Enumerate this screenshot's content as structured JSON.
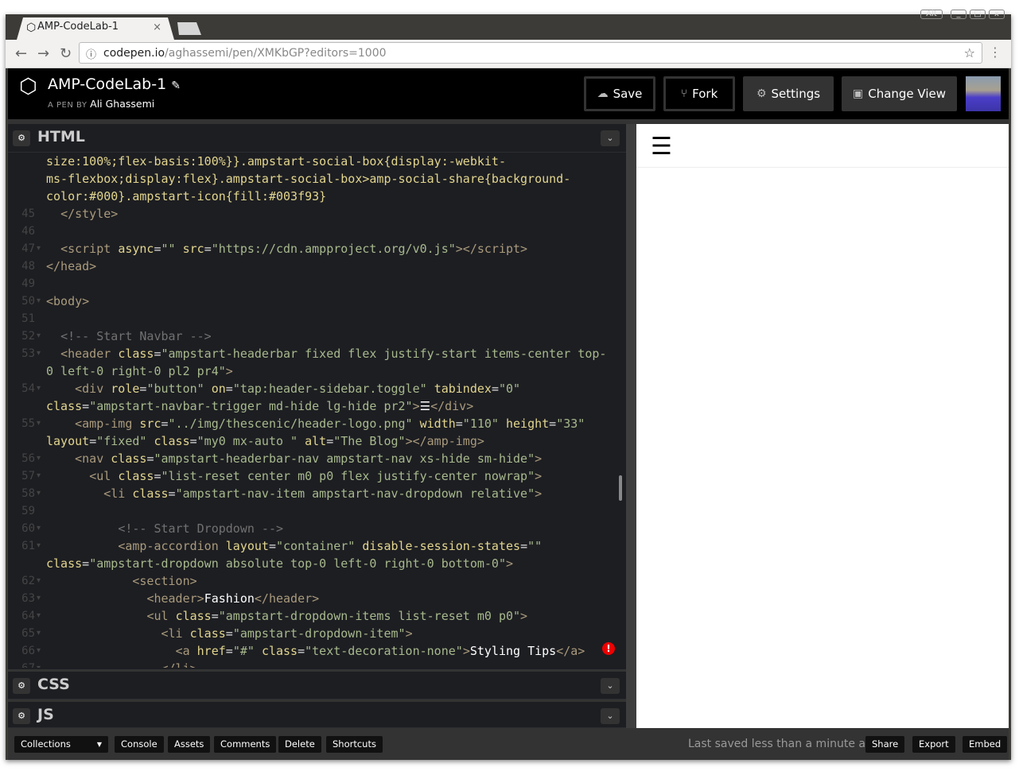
{
  "browser": {
    "tab_title": "AMP-CodeLab-1",
    "tab_icon": "codepen-logo-icon",
    "url_host": "codepen.io",
    "url_path": "/aghassemi/pen/XMKbGP?editors=1000",
    "window_controls": [
      "Alt",
      "_",
      "□",
      "x"
    ]
  },
  "header": {
    "title": "AMP-CodeLab-1",
    "by_label": "A PEN BY",
    "author": "Ali Ghassemi",
    "buttons": {
      "save": "Save",
      "fork": "Fork",
      "settings": "Settings",
      "change_view": "Change View"
    }
  },
  "panels": {
    "html": "HTML",
    "css": "CSS",
    "js": "JS"
  },
  "code_lines": [
    {
      "n": "",
      "f": false,
      "tokens": [
        [
          "a",
          "size:100%;flex-basis:100%}}.ampstart-social-box{display:-webkit-"
        ]
      ]
    },
    {
      "n": "",
      "f": false,
      "tokens": [
        [
          "a",
          "ms-flexbox;display:flex}.ampstart-social-box>amp-social-share{background-"
        ]
      ]
    },
    {
      "n": "",
      "f": false,
      "tokens": [
        [
          "a",
          "color:#000}.ampstart-icon{fill:#003f93}"
        ]
      ]
    },
    {
      "n": "45",
      "f": false,
      "tokens": [
        [
          "p",
          "  "
        ],
        [
          "t",
          "</style>"
        ]
      ]
    },
    {
      "n": "46",
      "f": false,
      "tokens": []
    },
    {
      "n": "47",
      "f": true,
      "tokens": [
        [
          "p",
          "  "
        ],
        [
          "t",
          "<script "
        ],
        [
          "a",
          "async"
        ],
        [
          "p",
          "="
        ],
        [
          "s",
          "\"\" "
        ],
        [
          "a",
          "src"
        ],
        [
          "p",
          "="
        ],
        [
          "s",
          "\"https://cdn.ampproject.org/v0.js\""
        ],
        [
          "t",
          "></script>"
        ]
      ]
    },
    {
      "n": "48",
      "f": false,
      "tokens": [
        [
          "t",
          "</head>"
        ]
      ]
    },
    {
      "n": "49",
      "f": false,
      "tokens": []
    },
    {
      "n": "50",
      "f": true,
      "tokens": [
        [
          "t",
          "<body>"
        ]
      ]
    },
    {
      "n": "51",
      "f": false,
      "tokens": []
    },
    {
      "n": "52",
      "f": true,
      "tokens": [
        [
          "p",
          "  "
        ],
        [
          "c",
          "<!-- Start Navbar -->"
        ]
      ]
    },
    {
      "n": "53",
      "f": true,
      "tokens": [
        [
          "p",
          "  "
        ],
        [
          "t",
          "<header "
        ],
        [
          "a",
          "class"
        ],
        [
          "p",
          "="
        ],
        [
          "s",
          "\"ampstart-headerbar fixed flex justify-start items-center top-"
        ]
      ]
    },
    {
      "n": "",
      "f": false,
      "tokens": [
        [
          "s",
          "0 left-0 right-0 pl2 pr4\""
        ],
        [
          "t",
          ">"
        ]
      ]
    },
    {
      "n": "54",
      "f": true,
      "tokens": [
        [
          "p",
          "    "
        ],
        [
          "t",
          "<div "
        ],
        [
          "a",
          "role"
        ],
        [
          "p",
          "="
        ],
        [
          "s",
          "\"button\" "
        ],
        [
          "a",
          "on"
        ],
        [
          "p",
          "="
        ],
        [
          "s",
          "\"tap:header-sidebar.toggle\" "
        ],
        [
          "a",
          "tabindex"
        ],
        [
          "p",
          "="
        ],
        [
          "s",
          "\"0\""
        ]
      ]
    },
    {
      "n": "",
      "f": false,
      "tokens": [
        [
          "a",
          "class"
        ],
        [
          "p",
          "="
        ],
        [
          "s",
          "\"ampstart-navbar-trigger md-hide lg-hide pr2\""
        ],
        [
          "t",
          ">"
        ],
        [
          "x",
          "☰"
        ],
        [
          "t",
          "</div>"
        ]
      ]
    },
    {
      "n": "55",
      "f": true,
      "tokens": [
        [
          "p",
          "    "
        ],
        [
          "t",
          "<amp-img "
        ],
        [
          "a",
          "src"
        ],
        [
          "p",
          "="
        ],
        [
          "s",
          "\"../img/thescenic/header-logo.png\" "
        ],
        [
          "a",
          "width"
        ],
        [
          "p",
          "="
        ],
        [
          "s",
          "\"110\" "
        ],
        [
          "a",
          "height"
        ],
        [
          "p",
          "="
        ],
        [
          "s",
          "\"33\""
        ]
      ]
    },
    {
      "n": "",
      "f": false,
      "tokens": [
        [
          "a",
          "layout"
        ],
        [
          "p",
          "="
        ],
        [
          "s",
          "\"fixed\" "
        ],
        [
          "a",
          "class"
        ],
        [
          "p",
          "="
        ],
        [
          "s",
          "\"my0 mx-auto \" "
        ],
        [
          "a",
          "alt"
        ],
        [
          "p",
          "="
        ],
        [
          "s",
          "\"The Blog\""
        ],
        [
          "t",
          "></amp-img>"
        ]
      ]
    },
    {
      "n": "56",
      "f": true,
      "tokens": [
        [
          "p",
          "    "
        ],
        [
          "t",
          "<nav "
        ],
        [
          "a",
          "class"
        ],
        [
          "p",
          "="
        ],
        [
          "s",
          "\"ampstart-headerbar-nav ampstart-nav xs-hide sm-hide\""
        ],
        [
          "t",
          ">"
        ]
      ]
    },
    {
      "n": "57",
      "f": true,
      "tokens": [
        [
          "p",
          "      "
        ],
        [
          "t",
          "<ul "
        ],
        [
          "a",
          "class"
        ],
        [
          "p",
          "="
        ],
        [
          "s",
          "\"list-reset center m0 p0 flex justify-center nowrap\""
        ],
        [
          "t",
          ">"
        ]
      ]
    },
    {
      "n": "58",
      "f": true,
      "tokens": [
        [
          "p",
          "        "
        ],
        [
          "t",
          "<li "
        ],
        [
          "a",
          "class"
        ],
        [
          "p",
          "="
        ],
        [
          "s",
          "\"ampstart-nav-item ampstart-nav-dropdown relative\""
        ],
        [
          "t",
          ">"
        ]
      ]
    },
    {
      "n": "59",
      "f": false,
      "tokens": []
    },
    {
      "n": "60",
      "f": true,
      "tokens": [
        [
          "p",
          "          "
        ],
        [
          "c",
          "<!-- Start Dropdown -->"
        ]
      ]
    },
    {
      "n": "61",
      "f": true,
      "tokens": [
        [
          "p",
          "          "
        ],
        [
          "t",
          "<amp-accordion "
        ],
        [
          "a",
          "layout"
        ],
        [
          "p",
          "="
        ],
        [
          "s",
          "\"container\" "
        ],
        [
          "a",
          "disable-session-states"
        ],
        [
          "p",
          "="
        ],
        [
          "s",
          "\"\""
        ]
      ]
    },
    {
      "n": "",
      "f": false,
      "tokens": [
        [
          "a",
          "class"
        ],
        [
          "p",
          "="
        ],
        [
          "s",
          "\"ampstart-dropdown absolute top-0 left-0 right-0 bottom-0\""
        ],
        [
          "t",
          ">"
        ]
      ]
    },
    {
      "n": "62",
      "f": true,
      "tokens": [
        [
          "p",
          "            "
        ],
        [
          "t",
          "<section>"
        ]
      ]
    },
    {
      "n": "63",
      "f": true,
      "tokens": [
        [
          "p",
          "              "
        ],
        [
          "t",
          "<header>"
        ],
        [
          "x",
          "Fashion"
        ],
        [
          "t",
          "</header>"
        ]
      ]
    },
    {
      "n": "64",
      "f": true,
      "tokens": [
        [
          "p",
          "              "
        ],
        [
          "t",
          "<ul "
        ],
        [
          "a",
          "class"
        ],
        [
          "p",
          "="
        ],
        [
          "s",
          "\"ampstart-dropdown-items list-reset m0 p0\""
        ],
        [
          "t",
          ">"
        ]
      ]
    },
    {
      "n": "65",
      "f": true,
      "tokens": [
        [
          "p",
          "                "
        ],
        [
          "t",
          "<li "
        ],
        [
          "a",
          "class"
        ],
        [
          "p",
          "="
        ],
        [
          "s",
          "\"ampstart-dropdown-item\""
        ],
        [
          "t",
          ">"
        ]
      ]
    },
    {
      "n": "66",
      "f": true,
      "tokens": [
        [
          "p",
          "                  "
        ],
        [
          "t",
          "<a "
        ],
        [
          "a",
          "href"
        ],
        [
          "p",
          "="
        ],
        [
          "s",
          "\"#\" "
        ],
        [
          "a",
          "class"
        ],
        [
          "p",
          "="
        ],
        [
          "s",
          "\"text-decoration-none\""
        ],
        [
          "t",
          ">"
        ],
        [
          "x",
          "Styling Tips"
        ],
        [
          "t",
          "</a>"
        ]
      ]
    },
    {
      "n": "67",
      "f": true,
      "tokens": [
        [
          "p",
          "                "
        ],
        [
          "t",
          "</li>"
        ]
      ]
    }
  ],
  "preview": {
    "menu_icon": "☰"
  },
  "footer": {
    "collections": "Collections",
    "buttons": [
      "Console",
      "Assets",
      "Comments",
      "Delete",
      "Shortcuts"
    ],
    "status": "Last saved less than a minute ago",
    "right_buttons": [
      "Share",
      "Export",
      "Embed"
    ]
  },
  "colors": {
    "tag": "#a99a7c",
    "attr": "#e2d58e",
    "string": "#a7b98d",
    "comment": "#717171",
    "error": "#ee0000"
  }
}
